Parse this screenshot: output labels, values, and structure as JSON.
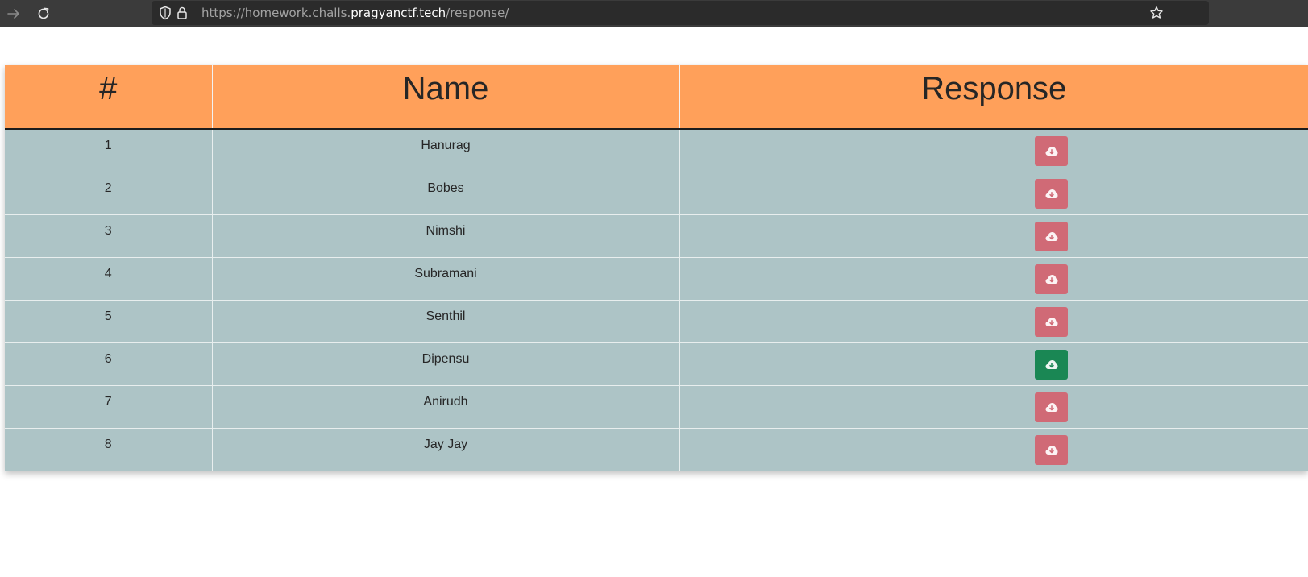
{
  "browser": {
    "url_prefix": "https://homework.challs.",
    "url_domain": "pragyanctf.tech",
    "url_path": "/response/"
  },
  "table": {
    "headers": [
      "#",
      "Name",
      "Response"
    ],
    "rows": [
      {
        "num": "1",
        "name": "Hanurag",
        "status": "danger"
      },
      {
        "num": "2",
        "name": "Bobes",
        "status": "danger"
      },
      {
        "num": "3",
        "name": "Nimshi",
        "status": "danger"
      },
      {
        "num": "4",
        "name": "Subramani",
        "status": "danger"
      },
      {
        "num": "5",
        "name": "Senthil",
        "status": "danger"
      },
      {
        "num": "6",
        "name": "Dipensu",
        "status": "success"
      },
      {
        "num": "7",
        "name": "Anirudh",
        "status": "danger"
      },
      {
        "num": "8",
        "name": "Jay Jay",
        "status": "danger"
      }
    ]
  },
  "icons": {
    "forward": "arrow-right-icon",
    "reload": "reload-icon",
    "tracking": "shield-icon",
    "security": "lock-icon",
    "bookmark": "star-icon",
    "download": "cloud-download-icon"
  },
  "colors": {
    "header_bg": "#ffa05a",
    "row_bg": "#adc4c6",
    "danger_button": "#d06a76",
    "success_button": "#1a8754"
  }
}
